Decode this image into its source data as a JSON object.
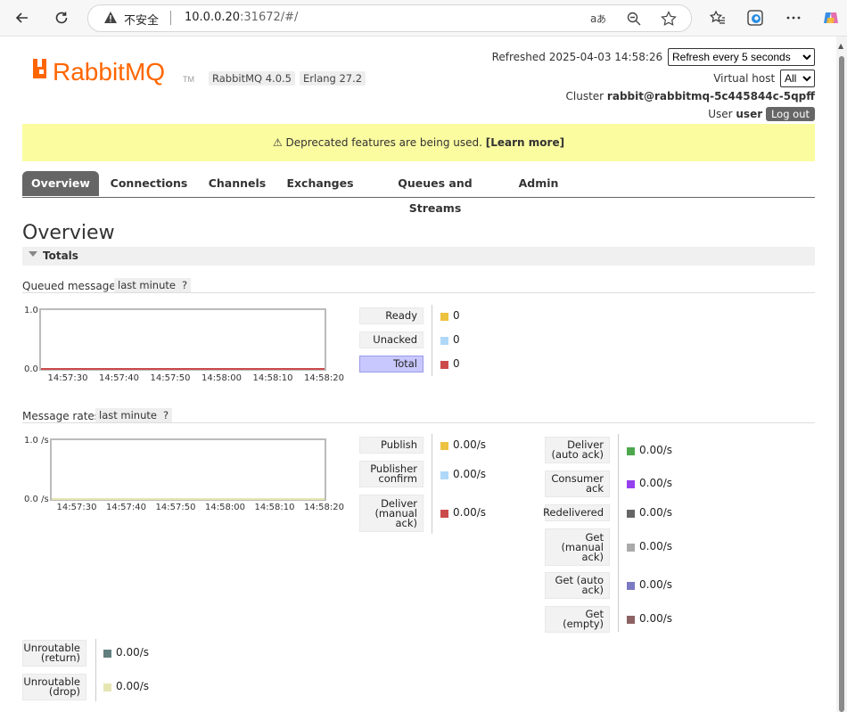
{
  "browser": {
    "insecure_label": "不安全",
    "url_host": "10.0.0.20",
    "url_rest": ":31672/#/"
  },
  "header": {
    "logo_text": "RabbitMQ",
    "logo_tm": "TM",
    "rabbitmq_version": "RabbitMQ 4.0.5",
    "erlang_version": "Erlang 27.2",
    "refreshed_label": "Refreshed 2025-04-03 14:58:26",
    "refresh_select": "Refresh every 5 seconds",
    "vhost_label": "Virtual host",
    "vhost_select": "All",
    "cluster_label": "Cluster",
    "cluster_name": "rabbit@rabbitmq-5c445844c-5qpff",
    "user_label": "User",
    "user_name": "user",
    "logout_label": "Log out"
  },
  "banner": {
    "text": "⚠ Deprecated features are being used.",
    "link": "[Learn more]"
  },
  "tabs": [
    "Overview",
    "Connections",
    "Channels",
    "Exchanges",
    "Queues and Streams",
    "Admin"
  ],
  "page_title": "Overview",
  "totals_label": "Totals",
  "queued": {
    "title": "Queued messages",
    "range": "last minute",
    "help": "?",
    "y_top": "1.0",
    "y_bottom": "0.0",
    "x_ticks": [
      "14:57:30",
      "14:57:40",
      "14:57:50",
      "14:58:00",
      "14:58:10",
      "14:58:20"
    ],
    "legend": [
      {
        "label": "Ready",
        "value": "0",
        "color": "#edc240"
      },
      {
        "label": "Unacked",
        "value": "0",
        "color": "#afd8f8"
      },
      {
        "label": "Total",
        "value": "0",
        "color": "#cb4b4b"
      }
    ]
  },
  "rates": {
    "title": "Message rates",
    "range": "last minute",
    "help": "?",
    "y_top": "1.0 /s",
    "y_bottom": "0.0 /s",
    "x_ticks": [
      "14:57:30",
      "14:57:40",
      "14:57:50",
      "14:58:00",
      "14:58:10",
      "14:58:20"
    ],
    "legend_left": [
      {
        "label": "Publish",
        "value": "0.00/s",
        "color": "#edc240"
      },
      {
        "label": "Publisher confirm",
        "value": "0.00/s",
        "color": "#afd8f8"
      },
      {
        "label": "Deliver (manual ack)",
        "value": "0.00/s",
        "color": "#cb4b4b"
      }
    ],
    "legend_right": [
      {
        "label": "Deliver (auto ack)",
        "value": "0.00/s",
        "color": "#4da74d"
      },
      {
        "label": "Consumer ack",
        "value": "0.00/s",
        "color": "#9440ed"
      },
      {
        "label": "Redelivered",
        "value": "0.00/s",
        "color": "#666666"
      },
      {
        "label": "Get (manual ack)",
        "value": "0.00/s",
        "color": "#aaaaaa"
      },
      {
        "label": "Get (auto ack)",
        "value": "0.00/s",
        "color": "#7c79c3"
      },
      {
        "label": "Get (empty)",
        "value": "0.00/s",
        "color": "#8d6262"
      }
    ],
    "legend_bottom": [
      {
        "label": "Unroutable (return)",
        "value": "0.00/s",
        "color": "#627f7f"
      },
      {
        "label": "Unroutable (drop)",
        "value": "0.00/s",
        "color": "#e6e6b3"
      }
    ]
  }
}
